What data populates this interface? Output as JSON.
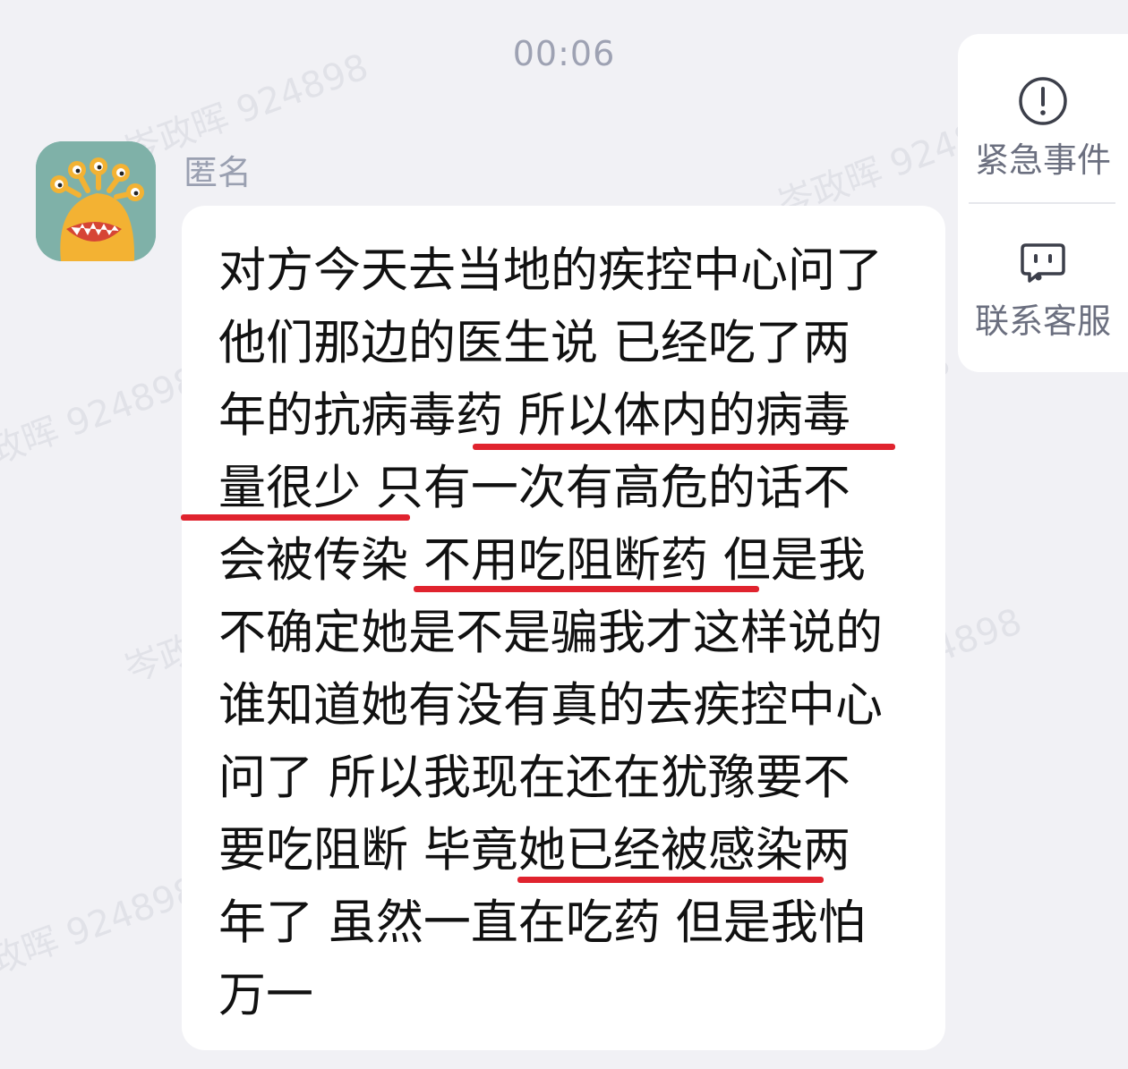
{
  "timestamp": "00:06",
  "sender": {
    "name": "匿名",
    "avatar_icon": "yellow-monster-avatar"
  },
  "message": {
    "lines": [
      "对方今天去当地的疾控中心问了",
      "他们那边的医生说 已经吃了两",
      "年的抗病毒药 所以体内的病毒",
      "量很少 只有一次有高危的话不",
      "会被传染 不用吃阻断药  但是我",
      "不确定她是不是骗我才这样说的",
      "谁知道她有没有真的去疾控中心",
      "问了 所以我现在还在犹豫要不",
      "要吃阻断 毕竟她已经被感染两",
      "年了 虽然一直在吃药 但是我怕",
      "万一"
    ],
    "underline_color": "#e0232e"
  },
  "side_panel": {
    "emergency": {
      "label": "紧急事件",
      "icon": "exclamation-circle-icon"
    },
    "support": {
      "label": "联系客服",
      "icon": "customer-service-icon"
    }
  },
  "watermark": {
    "text": "岑政晖  924898"
  },
  "colors": {
    "background": "#f1f1f5",
    "bubble": "#ffffff",
    "text": "#111111",
    "meta": "#9ea2b3"
  }
}
